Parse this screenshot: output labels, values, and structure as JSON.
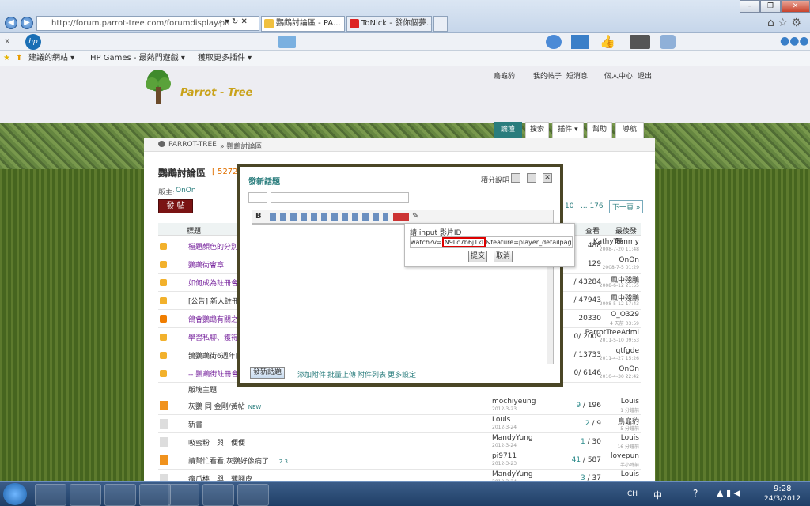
{
  "browser": {
    "address": "http://forum.parrot-tree.com/forumdisplay.ph",
    "tabs": [
      {
        "label": "鸚鵡討論區 - PA..."
      },
      {
        "label": "ToNick - 發你個夢..."
      }
    ],
    "search_engine": "bing",
    "close_x": "x"
  },
  "favorites": {
    "items": [
      {
        "label": "建議的網站 ▾"
      },
      {
        "label": "HP Games - 最熱門遊戲 ▾"
      },
      {
        "label": "獲取更多插件 ▾"
      }
    ]
  },
  "site": {
    "logo": "Parrot - Tree",
    "user_links": [
      "鳥龜豹",
      "我的帖子",
      "短消息",
      "個人中心",
      "退出"
    ],
    "nav_tabs": [
      "論壇",
      "搜索",
      "插件 ▾",
      "幫助",
      "導航"
    ],
    "breadcrumb": [
      "PARROT-TREE",
      "» 鸚鵡討論區"
    ],
    "forum_title": "鸚鵡討論區",
    "count": "[ 5272",
    "moderator_label": "版主:",
    "moderator": "OnOn",
    "post_button": "發 帖",
    "pager": [
      "10",
      "... 176",
      "下一頁 »"
    ],
    "col_title": "標題",
    "col_views": "查看",
    "col_last": "最後發表",
    "new_section": "版塊主題"
  },
  "threads": [
    {
      "title": "檔題顏色的分別",
      "purple": true,
      "stats": "488",
      "last": "KathyTommy",
      "last_date": "2008-7-20 11:48",
      "icon": "lock"
    },
    {
      "title": "鸚鵡街會章",
      "purple": true,
      "stats": "129",
      "last": "OnOn",
      "last_date": "2008-7-5 01:29",
      "icon": "lock"
    },
    {
      "title": "如何成為註冊會員",
      "purple": true,
      "stats": "/ 43284",
      "last": "鳳中殘鵬",
      "last_date": "2008-6-12 21:55",
      "icon": "lock"
    },
    {
      "title": "[公告] 新人註冊,",
      "purple": false,
      "stats": "/ 47943",
      "last": "鳳中殘鵬",
      "last_date": "2008-5-12 17:43",
      "icon": "lock"
    },
    {
      "title": "鴿會鸚鵡有關之檔",
      "purple": true,
      "stats": "20330",
      "last": "O_O329",
      "last_date": "4 天前 03:59",
      "icon": "up"
    },
    {
      "title": "學習私聊、獲得寵",
      "purple": true,
      "stats": "0/ 2009",
      "last": "ParrotTreeAdmi",
      "last_date": "2011-5-10 09:53",
      "icon": "lock"
    },
    {
      "title": "鵲鸚鵡街6週年的",
      "purple": false,
      "stats": "/ 13733",
      "last": "qtfgde",
      "last_date": "2011-4-27 15:26",
      "icon": "lock"
    },
    {
      "title": "-- 鸚鵡街註冊會員",
      "purple": true,
      "stats": "0/ 6146",
      "last": "OnOn",
      "last_date": "2010-4-30 22:42",
      "icon": "lock"
    }
  ],
  "threads2": [
    {
      "title": "灰鸚 同 金剛/黃帖",
      "badge": "NEW",
      "author": "mochiyeung",
      "date": "2012-3-23",
      "replies": "9",
      "views": "196",
      "last": "Louis",
      "last_date": "1 分鐘前",
      "hot": true
    },
    {
      "title": "新書",
      "badge": "",
      "author": "Louis",
      "date": "2012-3-24",
      "replies": "2",
      "views": "9",
      "last": "鳥龜豹",
      "last_date": "5 分鐘前",
      "hot": false
    },
    {
      "title": "吸蜜粉　與　便便",
      "badge": "",
      "author": "MandyYung",
      "date": "2012-3-24",
      "replies": "1",
      "views": "30",
      "last": "Louis",
      "last_date": "16 分鐘前",
      "hot": false
    },
    {
      "title": "請幫忙看看,灰鸚好像病了",
      "badge": "... 2 3",
      "author": "pi9711",
      "date": "2012-3-23",
      "replies": "41",
      "views": "587",
      "last": "lovepun",
      "last_date": "半小時前",
      "hot": true
    },
    {
      "title": "瘤爪棒　與　薄腳皮",
      "badge": "",
      "author": "MandyYung",
      "date": "2012-3-24",
      "replies": "3",
      "views": "37",
      "last": "Louis",
      "last_date": "",
      "hot": false
    }
  ],
  "dialog": {
    "title": "發新話題",
    "help": "積分說明",
    "submit": "發新話題",
    "links": [
      "添加附件",
      "批量上傳",
      "附件列表",
      "更多設定"
    ]
  },
  "popup": {
    "label": "請 input 影片ID",
    "prefix": "watch?v=",
    "video_id": "N9Lc7b6j1kl",
    "suffix": "&feature=player_detailpage",
    "ok": "提交",
    "cancel": "取消"
  },
  "taskbar": {
    "lang": "CH",
    "time": "9:28",
    "date": "24/3/2012",
    "ime": "中"
  }
}
